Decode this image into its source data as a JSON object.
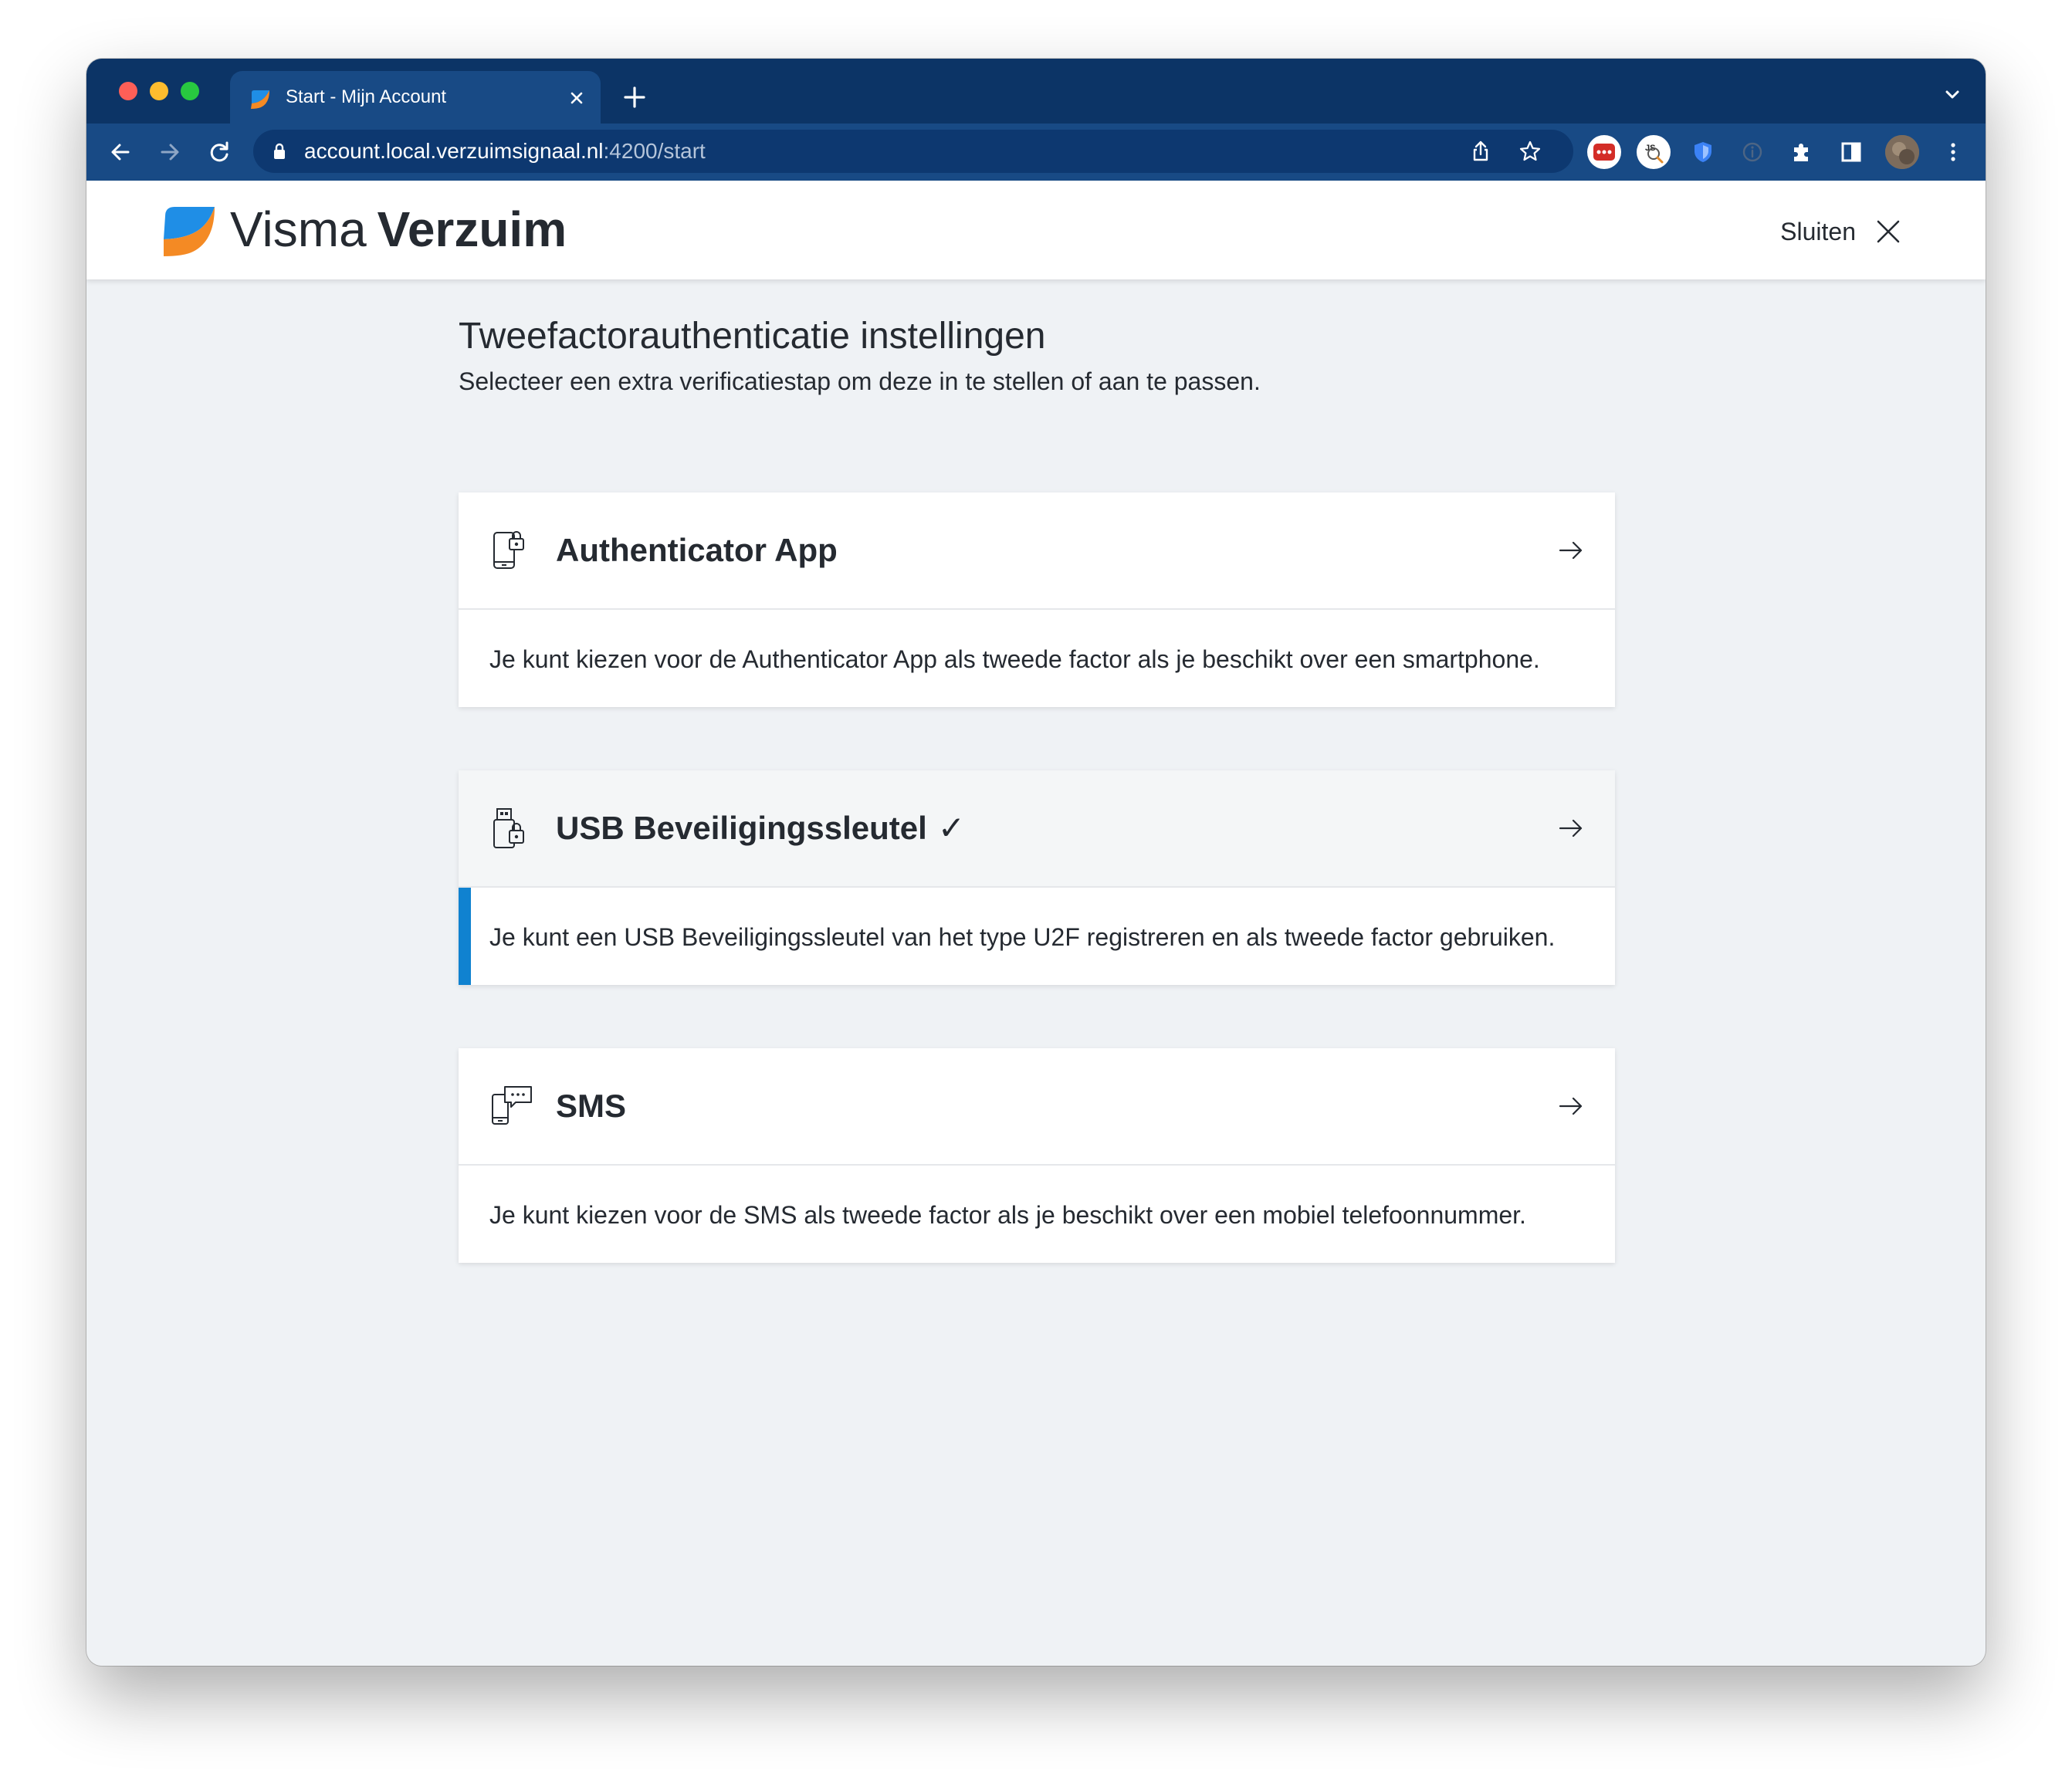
{
  "browser": {
    "tab_title": "Start - Mijn Account",
    "url_host": "account.local.verzuimsignaal.nl",
    "url_path": ":4200/start"
  },
  "header": {
    "brand_light": "Visma",
    "brand_bold": "Verzuim",
    "close_label": "Sluiten"
  },
  "page": {
    "title": "Tweefactorauthenticatie instellingen",
    "subtitle": "Selecteer een extra verificatiestap om deze in te stellen of aan te passen."
  },
  "options": [
    {
      "title": "Authenticator App",
      "description": "Je kunt kiezen voor de Authenticator App als tweede factor als je beschikt over een smartphone.",
      "icon": "phone-lock-icon",
      "configured": false
    },
    {
      "title": "USB Beveiligingssleutel",
      "check": "✓",
      "description": "Je kunt een USB Beveiligingssleutel van het type U2F registreren en als tweede factor gebruiken.",
      "icon": "usb-lock-icon",
      "configured": true
    },
    {
      "title": "SMS",
      "description": "Je kunt kiezen voor de SMS als tweede factor als je beschikt over een mobiel telefoonnummer.",
      "icon": "phone-message-icon",
      "configured": false
    }
  ],
  "colors": {
    "tabstrip": "#0c3466",
    "toolbar": "#184a85",
    "page_background": "#eff2f5",
    "active_accent": "#1082d0"
  }
}
